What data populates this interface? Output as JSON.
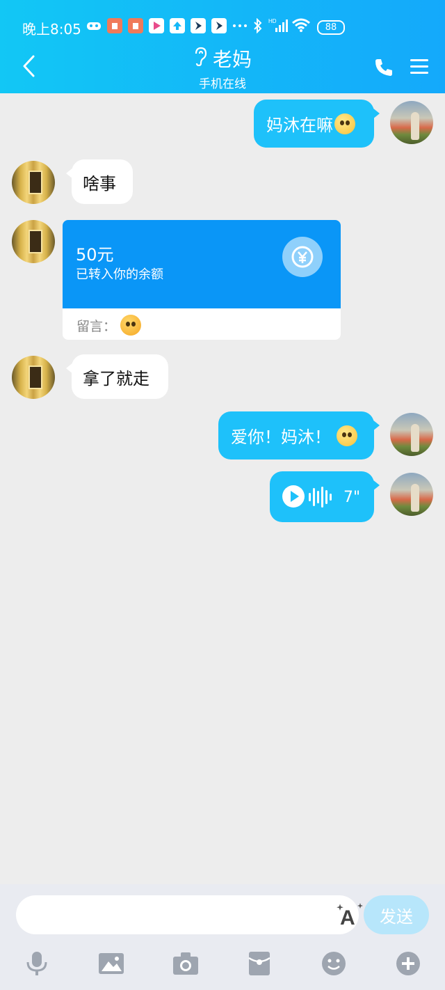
{
  "status": {
    "time": "晚上8:05",
    "battery": "88"
  },
  "header": {
    "title": "老妈",
    "subtitle": "手机在线"
  },
  "messages": [
    {
      "side": "right",
      "text": "妈沐在嘛",
      "emoji": "thinking-emoji"
    },
    {
      "side": "left",
      "text": "啥事"
    },
    {
      "side": "left",
      "type": "transfer",
      "amount": "50元",
      "desc": "已转入你的余额",
      "note_label": "留言：",
      "note_emoji": "kiss-emoji"
    },
    {
      "side": "left",
      "text": "拿了就走"
    },
    {
      "side": "right",
      "text": "爱你！妈沐！",
      "emoji": "cute-emoji"
    },
    {
      "side": "right",
      "type": "voice",
      "duration": "7\""
    }
  ],
  "input": {
    "placeholder": "",
    "send_label": "发送"
  },
  "toolbar": [
    "microphone-icon",
    "image-icon",
    "camera-icon",
    "red-packet-icon",
    "emoji-icon",
    "plus-icon"
  ],
  "colors": {
    "header": "#14a9fb",
    "bubble_self": "#1ec1fa",
    "transfer": "#0a96f7",
    "background": "#ededed"
  }
}
